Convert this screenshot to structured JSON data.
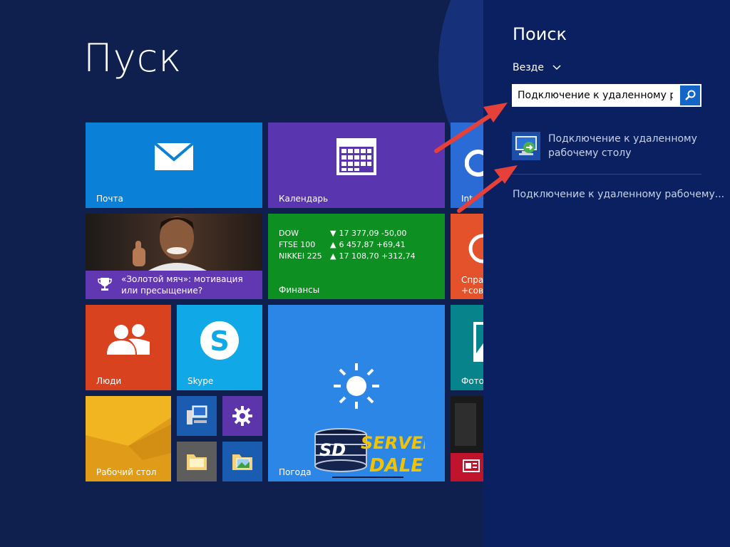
{
  "start": {
    "title": "Пуск"
  },
  "tiles": {
    "mail": "Почта",
    "calendar": "Календарь",
    "ie": "Int",
    "news": "«Золотой мяч»: мотивация или пресыщение?",
    "finance": {
      "label": "Финансы",
      "rows": [
        {
          "name": "DOW",
          "direction": "down",
          "value": "17 377,09 -50,00"
        },
        {
          "name": "FTSE 100",
          "direction": "up",
          "value": "6 457,87 +69,41"
        },
        {
          "name": "NIKKEI 225",
          "direction": "up",
          "value": "17 108,70 +312,74"
        }
      ]
    },
    "help": {
      "line1": "Справ",
      "line2": "+сове"
    },
    "people": "Люди",
    "skype": "Skype",
    "weather": "Погода",
    "photos": "Фото",
    "desktop": "Рабочий стол"
  },
  "search_panel": {
    "title": "Поиск",
    "scope": "Везде",
    "query": "Подключение к удаленному ра",
    "result": "Подключение к удаленному рабочему столу",
    "suggestion": "Подключение к удаленному рабочему..."
  },
  "watermark": {
    "text": "SD SERVER DALE"
  },
  "colors": {
    "background": "#0f1f4e",
    "panel": "#0a2060",
    "arrow": "#e5403a"
  }
}
